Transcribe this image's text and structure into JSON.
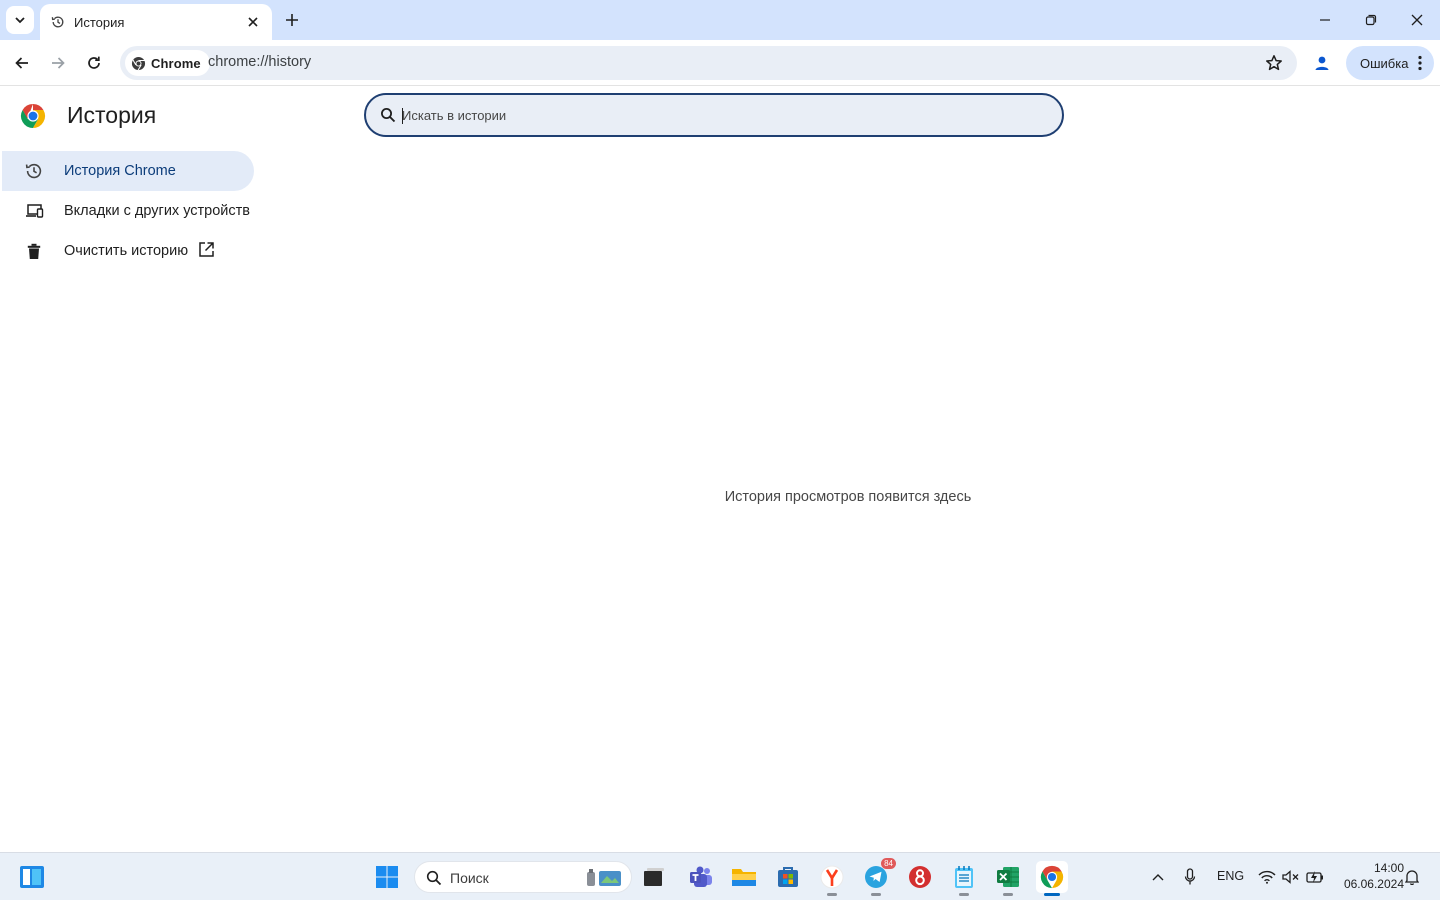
{
  "browser": {
    "tab": {
      "title": "История"
    },
    "url_chip_label": "Chrome",
    "url": "chrome://history",
    "profile_button_label": "Ошибка"
  },
  "page": {
    "title": "История",
    "search": {
      "placeholder": "Искать в истории",
      "value": ""
    },
    "sidebar": {
      "items": [
        {
          "label": "История Chrome",
          "icon": "history-icon",
          "active": true
        },
        {
          "label": "Вкладки с других устройств",
          "icon": "devices-icon",
          "active": false
        },
        {
          "label": "Очистить историю",
          "icon": "trash-icon",
          "active": false
        }
      ]
    },
    "empty_message": "История просмотров появится здесь"
  },
  "taskbar": {
    "search_label": "Поиск",
    "telegram_badge": "84",
    "language": "ENG",
    "time": "14:00",
    "date": "06.06.2024"
  },
  "colors": {
    "tabstrip": "#d3e3fd",
    "omnibox": "#e9eef6",
    "active_nav": "#e3ebf8",
    "search_border": "#1f3f72"
  }
}
